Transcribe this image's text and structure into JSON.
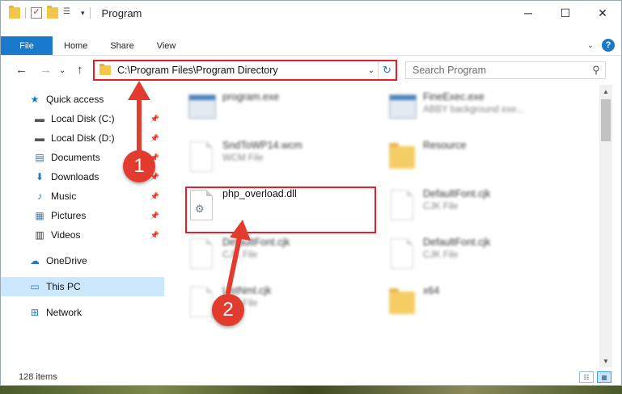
{
  "window": {
    "title": "Program"
  },
  "quick_access_toolbar": {
    "items": [
      "folder-icon",
      "properties-check-icon",
      "new-folder-icon",
      "customize-icon"
    ]
  },
  "window_controls": {
    "minimize": "─",
    "maximize": "☐",
    "close": "✕"
  },
  "ribbon": {
    "tabs": [
      "File",
      "Home",
      "Share",
      "View"
    ],
    "collapse_glyph": "⌄",
    "help_glyph": "?"
  },
  "nav": {
    "back": "←",
    "forward": "→",
    "recent": "⌄",
    "up": "↑",
    "address": "C:\\Program Files\\Program Directory",
    "address_dropdown": "⌄",
    "refresh": "↻",
    "search_placeholder": "Search Program",
    "search_glyph": "⚲"
  },
  "sidebar": {
    "items": [
      {
        "label": "Quick access",
        "icon": "star-icon",
        "glyph": "★",
        "color": "#1979ca",
        "pinned": false
      },
      {
        "label": "Local Disk (C:)",
        "icon": "drive-icon",
        "glyph": "▬",
        "color": "#555555",
        "pinned": true
      },
      {
        "label": "Local Disk (D:)",
        "icon": "drive-icon",
        "glyph": "▬",
        "color": "#555555",
        "pinned": true
      },
      {
        "label": "Documents",
        "icon": "documents-icon",
        "glyph": "▤",
        "color": "#4a6d8c",
        "pinned": true
      },
      {
        "label": "Downloads",
        "icon": "download-arrow-icon",
        "glyph": "⬇",
        "color": "#1979ca",
        "pinned": true
      },
      {
        "label": "Music",
        "icon": "music-note-icon",
        "glyph": "♪",
        "color": "#1979ca",
        "pinned": true
      },
      {
        "label": "Pictures",
        "icon": "pictures-icon",
        "glyph": "▦",
        "color": "#4a7da0",
        "pinned": true
      },
      {
        "label": "Videos",
        "icon": "film-icon",
        "glyph": "▥",
        "color": "#333333",
        "pinned": true
      },
      {
        "label": "OneDrive",
        "icon": "cloud-icon",
        "glyph": "☁",
        "color": "#1979ca",
        "pinned": false
      },
      {
        "label": "This PC",
        "icon": "monitor-icon",
        "glyph": "▭",
        "color": "#1979ca",
        "pinned": false,
        "selected": true
      },
      {
        "label": "Network",
        "icon": "network-icon",
        "glyph": "⊞",
        "color": "#1979ca",
        "pinned": false
      }
    ],
    "pin_glyph": "📌"
  },
  "files": [
    {
      "name": "program.exe",
      "type": "",
      "icon": "exe",
      "blurred": true
    },
    {
      "name": "FineExec.exe",
      "type": "ABBY background exe...",
      "icon": "exe",
      "blurred": true
    },
    {
      "name": "SndToWP14.wcm",
      "type": "WCM File",
      "icon": "doc",
      "blurred": true
    },
    {
      "name": "Resource",
      "type": "",
      "icon": "folder",
      "blurred": true
    },
    {
      "name": "php_overload.dll",
      "type": "",
      "icon": "dll",
      "blurred": false
    },
    {
      "name": "DefaultFont.cjk",
      "type": "CJK File",
      "icon": "doc",
      "blurred": true
    },
    {
      "name": "DefaultFont.cjk",
      "type": "CJK File",
      "icon": "doc",
      "blurred": true
    },
    {
      "name": "DefaultFont.cjk",
      "type": "CJK File",
      "icon": "doc",
      "blurred": true
    },
    {
      "name": "ListNml.cjk",
      "type": "CJK File",
      "icon": "doc",
      "blurred": true
    },
    {
      "name": "x64",
      "type": "",
      "icon": "folder",
      "blurred": true
    }
  ],
  "status": {
    "item_count": "128 items"
  },
  "annotations": [
    {
      "label": "1",
      "color": "#e23c2f"
    },
    {
      "label": "2",
      "color": "#e23c2f"
    }
  ],
  "colors": {
    "accent": "#1979ca",
    "highlight_red": "#e81e25",
    "selected_bg": "#cce8ff"
  }
}
